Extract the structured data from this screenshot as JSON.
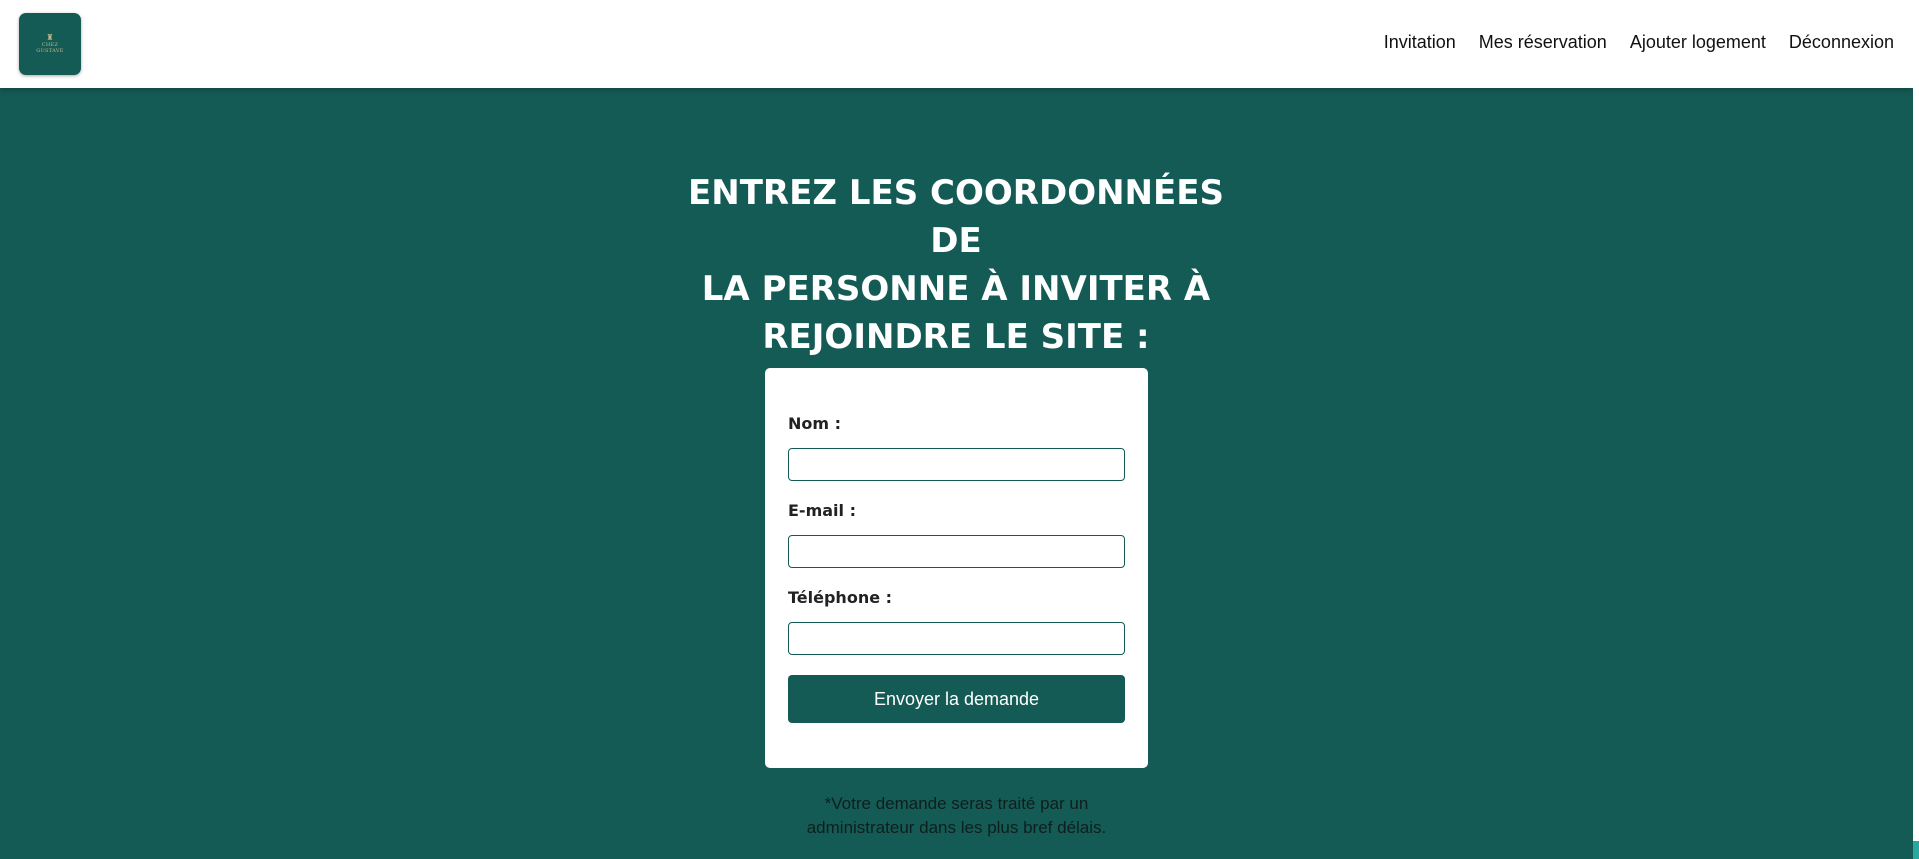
{
  "header": {
    "logo": {
      "mark": "♜",
      "text_line1": "CHEZ",
      "text_line2": "GUSTAVE"
    },
    "nav": [
      {
        "label": "Invitation"
      },
      {
        "label": "Mes réservation"
      },
      {
        "label": "Ajouter logement"
      },
      {
        "label": "Déconnexion"
      }
    ]
  },
  "main": {
    "title_lines": [
      "ENTREZ LES COORDONNÉES DE",
      "LA PERSONNE À INVITER À",
      "REJOINDRE LE SITE :"
    ],
    "form": {
      "nom_label": "Nom :",
      "nom_value": "",
      "email_label": "E-mail :",
      "email_value": "",
      "telephone_label": "Téléphone :",
      "telephone_value": "",
      "submit_label": "Envoyer la demande"
    },
    "note_lines": [
      "*Votre demande seras traité par un",
      "administrateur dans les plus bref délais."
    ]
  },
  "colors": {
    "primary": "#155b55",
    "background": "#155b55",
    "header_bg": "#ffffff",
    "scrollbar_thumb": "#2aa8a0"
  }
}
